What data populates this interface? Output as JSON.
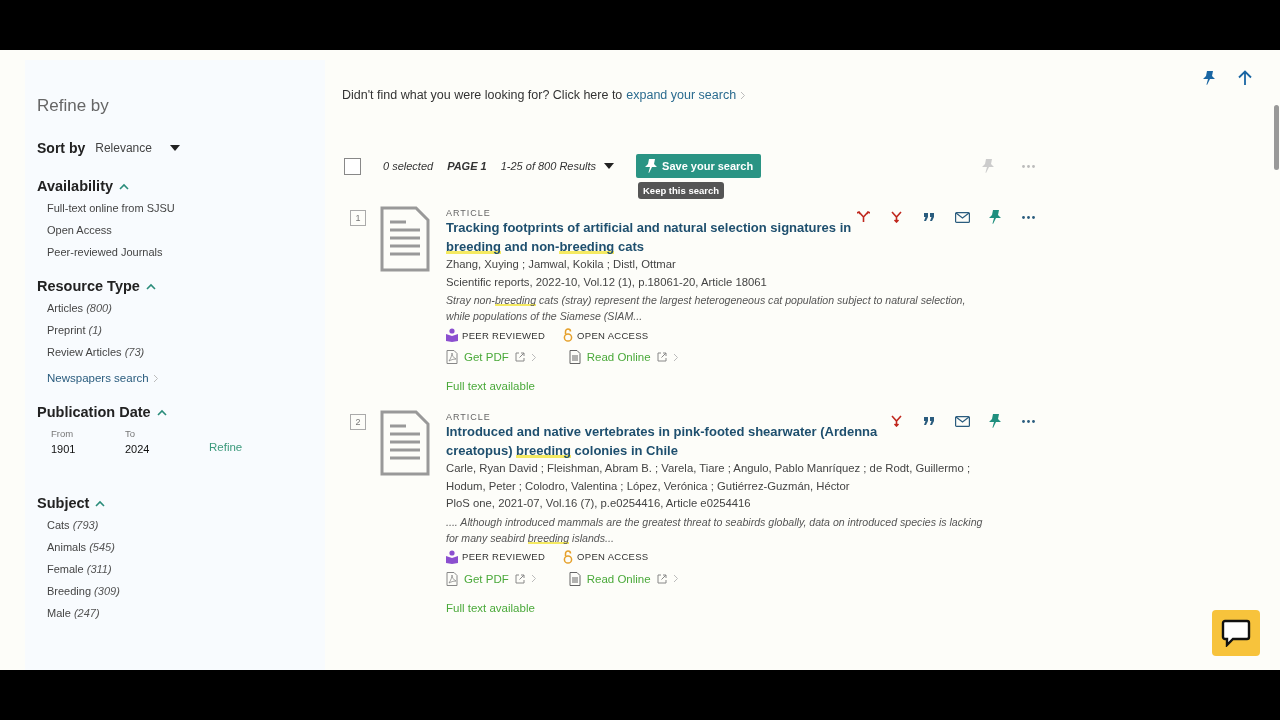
{
  "sidebar": {
    "title": "Refine by",
    "sort": {
      "label": "Sort by",
      "value": "Relevance"
    },
    "sections": [
      {
        "title": "Availability",
        "expanded": true,
        "items": [
          {
            "label": "Full-text online from SJSU"
          },
          {
            "label": "Open Access"
          },
          {
            "label": "Peer-reviewed Journals"
          }
        ]
      },
      {
        "title": "Resource Type",
        "expanded": true,
        "items": [
          {
            "label": "Articles",
            "count": "(800)"
          },
          {
            "label": "Preprint",
            "count": "(1)"
          },
          {
            "label": "Review Articles",
            "count": "(73)"
          }
        ],
        "link": "Newspapers search"
      },
      {
        "title": "Publication Date",
        "expanded": true,
        "date": {
          "from_label": "From",
          "from": "1901",
          "to_label": "To",
          "to": "2024",
          "button": "Refine"
        }
      },
      {
        "title": "Subject",
        "expanded": true,
        "items": [
          {
            "label": "Cats",
            "count": "(793)"
          },
          {
            "label": "Animals",
            "count": "(545)"
          },
          {
            "label": "Female",
            "count": "(311)"
          },
          {
            "label": "Breeding",
            "count": "(309)"
          },
          {
            "label": "Male",
            "count": "(247)"
          }
        ]
      }
    ]
  },
  "notice": {
    "text": "Didn't find what you were looking for? Click here to",
    "link": "expand your search"
  },
  "toolbar": {
    "checked": false,
    "selected": "0 selected",
    "page": "PAGE 1",
    "range": "1-25 of 800 Results",
    "save_button": "Save your search",
    "tooltip": "Keep this search"
  },
  "results": [
    {
      "number": "1",
      "type": "ARTICLE",
      "title": [
        {
          "text": "Tracking footprints of artificial and natural selection signatures in ",
          "highlighted": false
        },
        {
          "text": "breeding",
          "highlighted": true
        },
        {
          "text": " and non-",
          "highlighted": false
        },
        {
          "text": "breeding",
          "highlighted": true
        },
        {
          "text": " cats",
          "highlighted": false
        }
      ],
      "authors": "Zhang, Xuying ; Jamwal, Kokila ; Distl, Ottmar",
      "source": "Scientific reports, 2022-10, Vol.12 (1), p.18061-20, Article 18061",
      "snippet": [
        {
          "text": "Stray non-",
          "highlighted": false
        },
        {
          "text": "breeding",
          "highlighted": true
        },
        {
          "text": " cats (stray) represent the largest heterogeneous cat population subject to natural selection, while populations of the Siamese (SIAM...",
          "highlighted": false
        }
      ],
      "badges": [
        {
          "kind": "peer",
          "label": "PEER REVIEWED"
        },
        {
          "kind": "open",
          "label": "OPEN ACCESS"
        }
      ],
      "links": [
        {
          "kind": "pdf",
          "label": "Get PDF"
        },
        {
          "kind": "online",
          "label": "Read Online"
        }
      ],
      "availability": "Full text available",
      "actions": [
        {
          "kind": "links"
        },
        {
          "kind": "cited"
        },
        {
          "kind": "cite"
        },
        {
          "kind": "email"
        },
        {
          "kind": "pin"
        },
        {
          "kind": "more"
        }
      ]
    },
    {
      "number": "2",
      "type": "ARTICLE",
      "title": [
        {
          "text": "Introduced and native vertebrates in pink-footed shearwater (Ardenna creatopus) ",
          "highlighted": false
        },
        {
          "text": "breeding",
          "highlighted": true
        },
        {
          "text": " colonies in Chile",
          "highlighted": false
        }
      ],
      "authors": "Carle, Ryan David ; Fleishman, Abram B. ; Varela, Tiare ; Angulo, Pablo Manríquez ; de Rodt, Guillermo ; Hodum, Peter ; Colodro, Valentina ; López, Verónica ; Gutiérrez-Guzmán, Héctor",
      "source": "PloS one, 2021-07, Vol.16 (7), p.e0254416, Article e0254416",
      "snippet": [
        {
          "text": ".... Although introduced mammals are the greatest threat to seabirds globally, data on introduced species is lacking for many seabird ",
          "highlighted": false
        },
        {
          "text": "breeding",
          "highlighted": true
        },
        {
          "text": " islands...",
          "highlighted": false
        }
      ],
      "badges": [
        {
          "kind": "peer",
          "label": "PEER REVIEWED"
        },
        {
          "kind": "open",
          "label": "OPEN ACCESS"
        }
      ],
      "links": [
        {
          "kind": "pdf",
          "label": "Get PDF"
        },
        {
          "kind": "online",
          "label": "Read Online"
        }
      ],
      "availability": "Full text available",
      "actions": [
        {
          "kind": "cited"
        },
        {
          "kind": "cite"
        },
        {
          "kind": "email"
        },
        {
          "kind": "pin"
        },
        {
          "kind": "more"
        }
      ]
    }
  ]
}
